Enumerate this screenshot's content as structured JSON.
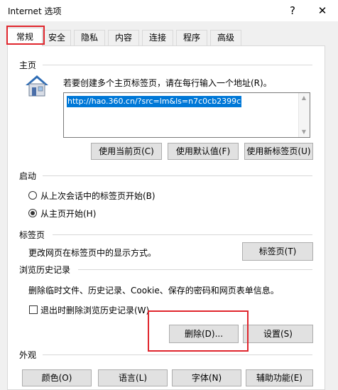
{
  "window": {
    "title": "Internet 选项",
    "help_glyph": "?",
    "close_glyph": "✕"
  },
  "tabs": [
    {
      "label": "常规",
      "active": true
    },
    {
      "label": "安全"
    },
    {
      "label": "隐私"
    },
    {
      "label": "内容"
    },
    {
      "label": "连接"
    },
    {
      "label": "程序"
    },
    {
      "label": "高级"
    }
  ],
  "home": {
    "section": "主页",
    "hint": "若要创建多个主页标签页，请在每行输入一个地址(R)。",
    "url": "http://hao.360.cn/?src=lm&ls=n7c0cb2399c",
    "btn_current": "使用当前页(C)",
    "btn_default": "使用默认值(F)",
    "btn_newtab": "使用新标签页(U)",
    "icon": "house-icon"
  },
  "startup": {
    "section": "启动",
    "option_last": "从上次会话中的标签页开始(B)",
    "option_home": "从主页开始(H)",
    "selected": "home"
  },
  "tabs_section": {
    "section": "标签页",
    "desc": "更改网页在标签页中的显示方式。",
    "btn": "标签页(T)"
  },
  "history": {
    "section": "浏览历史记录",
    "desc": "删除临时文件、历史记录、Cookie、保存的密码和网页表单信息。",
    "checkbox": "退出时删除浏览历史记录(W)",
    "checked": false,
    "btn_delete": "删除(D)...",
    "btn_settings": "设置(S)"
  },
  "appearance": {
    "section": "外观",
    "btn_colors": "颜色(O)",
    "btn_language": "语言(L)",
    "btn_fonts": "字体(N)",
    "btn_accessibility": "辅助功能(E)"
  },
  "colors": {
    "highlight": "#e0262d",
    "selection": "#0078d7"
  }
}
